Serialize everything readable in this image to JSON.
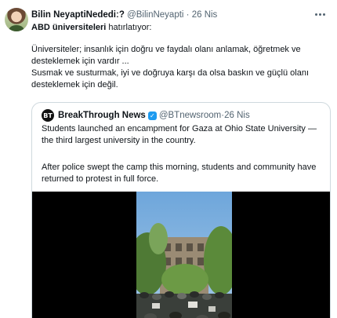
{
  "tweet": {
    "author_name": "Bilin NeyaptiNedediː?",
    "author_handle": "@BilinNeyapti",
    "separator": " · ",
    "date": "26 Nis",
    "line1_bold": "ABD üniversiteleri",
    "line1_rest": " hatırlatıyor:",
    "paragraph1": "Üniversiteler; insanlık için doğru ve faydalı olanı anlamak, öğretmek ve desteklemek için vardır ...",
    "paragraph2": "Susmak ve susturmak, iyi ve doğruya karşı da olsa baskın ve güçlü olanı desteklemek için değil.",
    "icons": {
      "more": "more-horizontal-icon"
    }
  },
  "quote": {
    "author_name": "BreakThrough News",
    "author_handle": "@BTnewsroom",
    "separator": " · ",
    "date": "26 Nis",
    "logo_text": "BT",
    "verified_mark": "✓",
    "paragraph1": "Students launched an encampment for Gaza at Ohio State University — the third largest university in the country.",
    "paragraph2": "After police swept the camp this morning, students and community have returned to protest in full force.",
    "icons": {
      "verified": "verified-badge-icon",
      "logo": "breakthrough-logo-icon"
    }
  },
  "media": {
    "type": "video",
    "background_color": "#000000",
    "accent_color": "#1d9bf0"
  }
}
